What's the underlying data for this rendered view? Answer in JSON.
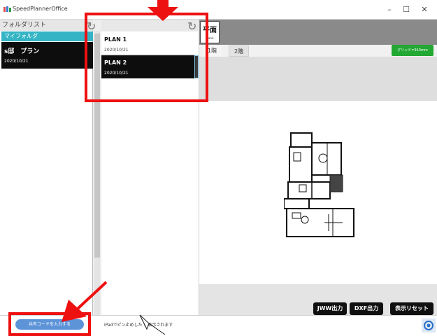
{
  "window": {
    "title": "SpeedPlannerOffice",
    "minimize": "–",
    "maximize": "☐",
    "close": "✕"
  },
  "folder_panel": {
    "header": "フォルダリスト",
    "my_folder": "マイフォルダ",
    "plan_folder": {
      "name": "s邸　プラン",
      "date": "2020/10/21"
    }
  },
  "plan_list": {
    "refresh_glyph": "↻",
    "items": [
      {
        "name": "PLAN 1",
        "date": "2020/10/21"
      },
      {
        "name": "PLAN 2",
        "date": "2020/10/21"
      }
    ]
  },
  "main": {
    "plane_button": {
      "label": "平面",
      "sublabel": "Plane"
    },
    "floor_tabs": [
      "1階",
      "2階"
    ],
    "grid_label": "グリッド=910mm",
    "buttons": {
      "jww": "JWW出力",
      "dxf": "DXF出力",
      "reset": "表示リセット"
    }
  },
  "status_bar": {
    "share_button": "共有コードを入力する",
    "message": "iPadでピン止めした    が表示されます"
  },
  "colors": {
    "accent_teal": "#34b4c4",
    "selected_dark": "#0d0d0d",
    "grid_green": "#22a833",
    "share_blue": "#5d94d8",
    "annotation_red": "#ee1111"
  },
  "icons": [
    "app-icon",
    "refresh-icon",
    "settings-icon",
    "cursor-icon",
    "arrow-annotation"
  ]
}
